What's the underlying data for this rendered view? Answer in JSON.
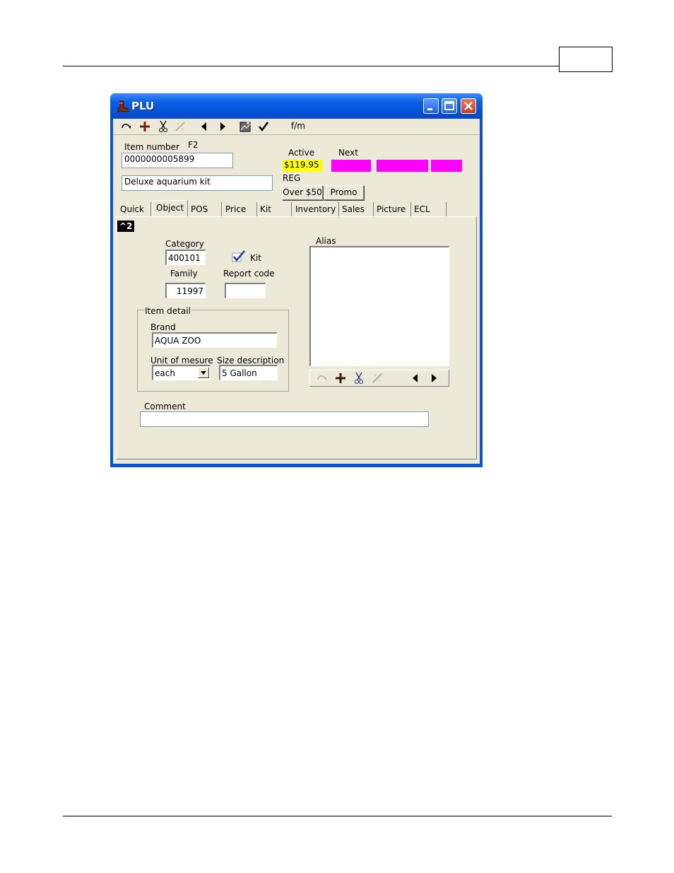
{
  "window": {
    "title": "PLU",
    "toolbar_text": "f/m"
  },
  "header": {
    "item_number_label": "Item number",
    "item_number_hotkey": "F2",
    "item_number_value": "0000000005899",
    "description_value": "Deluxe aquarium kit",
    "active_label": "Active",
    "next_label": "Next",
    "active_price": "$119.95",
    "reg_label": "REG",
    "over_button": "Over $50",
    "promo_button": "Promo"
  },
  "tabs": [
    {
      "label": "Quick"
    },
    {
      "label": "Object"
    },
    {
      "label": "POS"
    },
    {
      "label": "Price"
    },
    {
      "label": "Kit"
    },
    {
      "label": "Inventory"
    },
    {
      "label": "Sales"
    },
    {
      "label": "Picture"
    },
    {
      "label": "ECL"
    }
  ],
  "active_tab": "Object",
  "object": {
    "badge": "^2",
    "category_label": "Category",
    "category_value": "400101",
    "kit_label": "Kit",
    "kit_checked": true,
    "family_label": "Family",
    "family_value": "11997",
    "report_code_label": "Report code",
    "report_code_value": "",
    "item_detail_title": "Item detail",
    "brand_label": "Brand",
    "brand_value": "AQUA ZOO",
    "unit_label": "Unit of mesure",
    "unit_value": "each",
    "size_label": "Size description",
    "size_value": "5 Gallon",
    "alias_label": "Alias",
    "comment_label": "Comment",
    "comment_value": ""
  },
  "colors": {
    "title_bar": "#0a5fe4",
    "active_price_bg": "#ffff00",
    "next_price_bg": "#ff00ff",
    "client_bg": "#ece9d8"
  },
  "icons": [
    "undo-icon",
    "add-icon",
    "cut-icon",
    "edit-icon",
    "prev-icon",
    "next-icon",
    "image-icon",
    "check-icon"
  ]
}
